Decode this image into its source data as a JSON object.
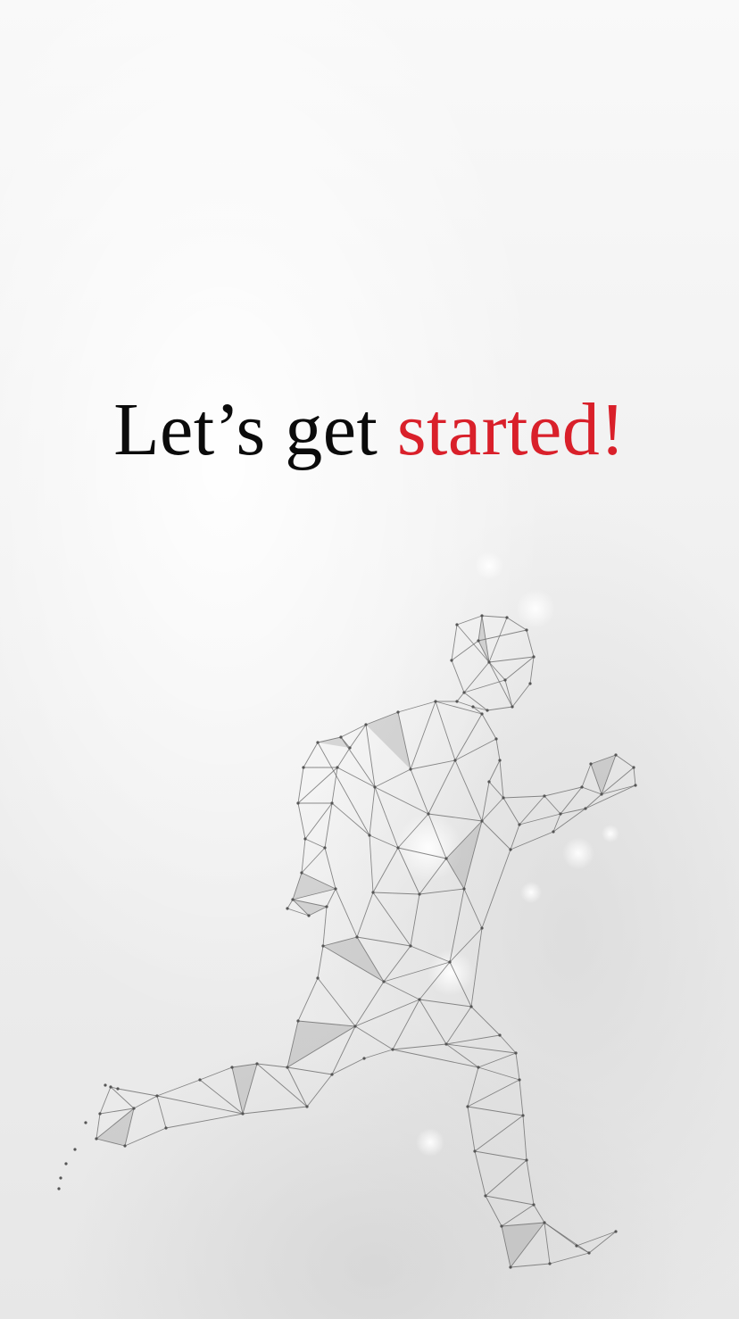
{
  "screen": {
    "headline_plain": "Let’s get ",
    "headline_highlight": "started!"
  },
  "colors": {
    "text": "#0b0b0b",
    "accent": "#d9202a",
    "background": "#f4f4f4",
    "mesh_line": "#6b6b6b"
  },
  "illustration": {
    "icon": "polygon-mesh-runner-icon"
  }
}
